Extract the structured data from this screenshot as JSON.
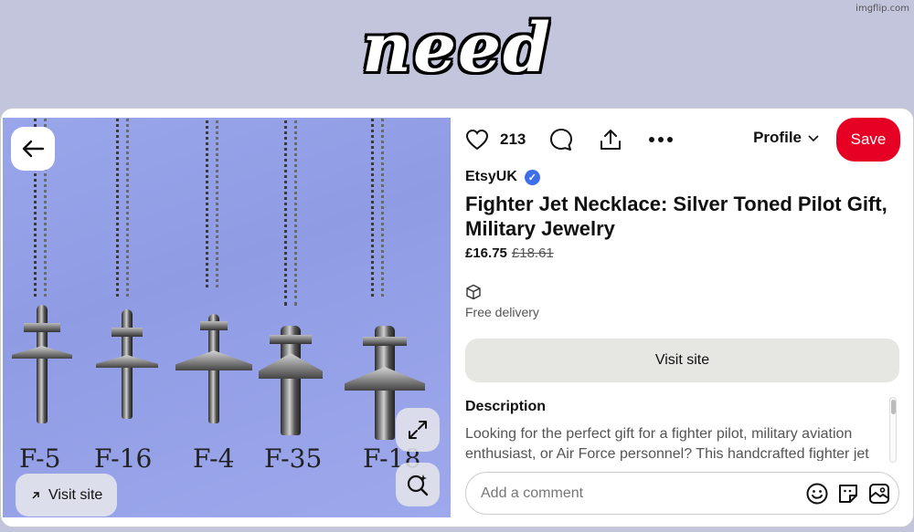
{
  "watermark": "imgflip.com",
  "meme_caption": "need",
  "image": {
    "labels": [
      "F-5",
      "F-16",
      "F-4",
      "F-35",
      "F-18"
    ],
    "visit_site_label": "Visit site"
  },
  "actions": {
    "like_count": "213",
    "profile_label": "Profile",
    "save_label": "Save"
  },
  "product": {
    "seller": "EtsyUK",
    "title": "Fighter Jet Necklace: Silver Toned Pilot Gift, Military Jewelry",
    "price_now": "£16.75",
    "price_old": "£18.61",
    "delivery": "Free delivery",
    "visit_site_label": "Visit site",
    "description_heading": "Description",
    "description_text": "Looking for the perfect gift for a fighter pilot, military aviation enthusiast, or Air Force personnel? This handcrafted fighter jet"
  },
  "comment": {
    "placeholder": "Add a comment"
  },
  "colors": {
    "save_button": "#e60023",
    "verified_badge": "#3f6fe8",
    "meme_background": "#c3c5dd"
  }
}
